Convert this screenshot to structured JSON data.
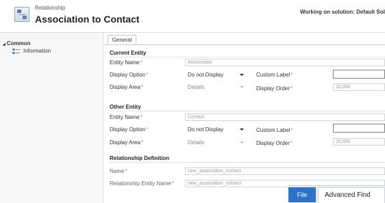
{
  "header": {
    "entity_type": "Relationship",
    "title": "Association to Contact",
    "solution_text": "Working on solution: Default Solu"
  },
  "sidebar": {
    "group": "Common",
    "items": [
      {
        "label": "Information"
      }
    ]
  },
  "tabs": [
    {
      "label": "General"
    }
  ],
  "current_entity": {
    "heading": "Current Entity",
    "entity_name_label": "Entity Name",
    "entity_name_value": "Association",
    "display_option_label": "Display Option",
    "display_option_value": "Do not Display",
    "custom_label_label": "Custom Label",
    "custom_label_value": "",
    "display_area_label": "Display Area",
    "display_area_value": "Details",
    "display_order_label": "Display Order",
    "display_order_value": "10,000"
  },
  "other_entity": {
    "heading": "Other Entity",
    "entity_name_label": "Entity Name",
    "entity_name_value": "Contact",
    "display_option_label": "Display Option",
    "display_option_value": "Do not Display",
    "custom_label_label": "Custom Label",
    "custom_label_value": "",
    "display_area_label": "Display Area",
    "display_area_value": "Details",
    "display_order_label": "Display Order",
    "display_order_value": "10,000"
  },
  "relationship_definition": {
    "heading": "Relationship Definition",
    "name_label": "Name",
    "name_value": "new_association_contact",
    "rel_entity_name_label": "Relationship Entity Name",
    "rel_entity_name_value": "new_association_contact"
  },
  "ribbon": {
    "file_label": "File",
    "advanced_find_label": "Advanced Find"
  },
  "required_marker": "*",
  "expander": "◢",
  "colors": {
    "required": "#e8737b",
    "file_tab": "#2f73c9",
    "sidebar_bg": "#f6f7f9"
  },
  "icons": {
    "relationship": "relationship-icon",
    "information": "information-icon",
    "expander": "expand-triangle-icon"
  }
}
